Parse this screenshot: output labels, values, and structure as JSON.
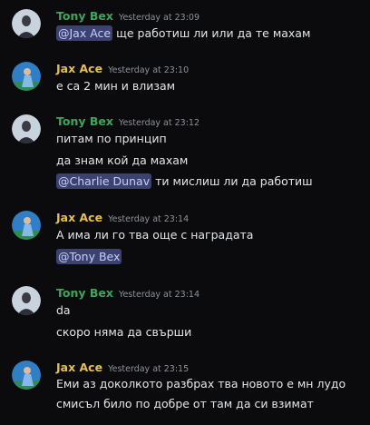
{
  "colors": {
    "background": "#0b0b0d",
    "tony_name": "#3ba55c",
    "jax_name": "#e6c04a",
    "mention_bg": "#3c4270",
    "mention_text": "#c9cdfb",
    "timestamp": "#8e9297"
  },
  "messages": [
    {
      "author": "Tony Bex",
      "timestamp": "Yesterday at 23:09",
      "lines": [
        {
          "mention": "@Jax Ace",
          "text": " ще работиш ли или да те махам"
        }
      ]
    },
    {
      "author": "Jax Ace",
      "timestamp": "Yesterday at 23:10",
      "lines": [
        {
          "text": "е са 2 мин и влизам"
        }
      ]
    },
    {
      "author": "Tony Bex",
      "timestamp": "Yesterday at 23:12",
      "lines": [
        {
          "text": "питам по принцип"
        },
        {
          "text": "да знам кой да махам"
        },
        {
          "mention": "@Charlie Dunav",
          "text": " ти мислиш ли да работиш"
        }
      ]
    },
    {
      "author": "Jax Ace",
      "timestamp": "Yesterday at 23:14",
      "lines": [
        {
          "text": "А има ли го тва още с наградата"
        },
        {
          "mention": "@Tony Bex"
        }
      ]
    },
    {
      "author": "Tony Bex",
      "timestamp": "Yesterday at 23:14",
      "lines": [
        {
          "text": "da"
        },
        {
          "text": "скоро няма да свърши"
        }
      ]
    },
    {
      "author": "Jax Ace",
      "timestamp": "Yesterday at 23:15",
      "lines": [
        {
          "text": "Еми аз доколкото разбрах тва новото е мн лудо"
        },
        {
          "text": "смисъл било по добре от там да си взимат"
        }
      ]
    }
  ]
}
